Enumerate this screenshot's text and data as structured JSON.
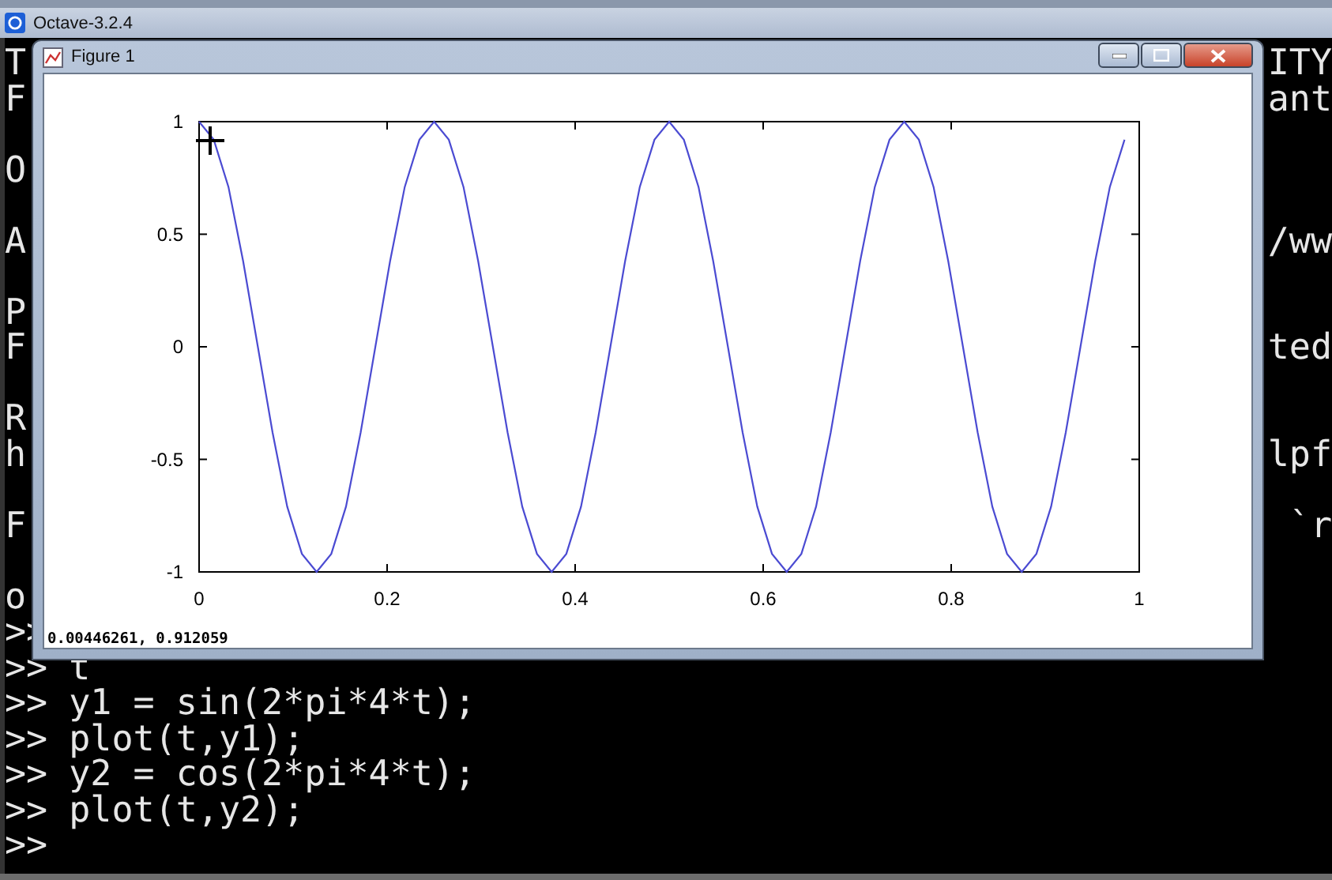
{
  "console": {
    "title": "Octave-3.2.4",
    "lines": [
      {
        "kind": "text",
        "left": "T",
        "right": "ITY"
      },
      {
        "kind": "text",
        "left": "F",
        "right": "ant"
      },
      {
        "kind": "blank"
      },
      {
        "kind": "text",
        "left": "O"
      },
      {
        "kind": "blank"
      },
      {
        "kind": "text",
        "left": "A",
        "right": "/ww"
      },
      {
        "kind": "blank"
      },
      {
        "kind": "text",
        "left": "P"
      },
      {
        "kind": "text",
        "left": "F",
        "right": "ted"
      },
      {
        "kind": "blank"
      },
      {
        "kind": "text",
        "left": "R"
      },
      {
        "kind": "text",
        "left": "h",
        "right": "lpf"
      },
      {
        "kind": "blank"
      },
      {
        "kind": "text",
        "left": "F",
        "right": "`r"
      },
      {
        "kind": "blank"
      },
      {
        "kind": "text",
        "left": "o"
      },
      {
        "kind": "text",
        "left": ">>"
      },
      {
        "kind": "text",
        "left": ">> t"
      },
      {
        "kind": "text",
        "left": ">> y1 = sin(2*pi*4*t);"
      },
      {
        "kind": "text",
        "left": ">> plot(t,y1);"
      },
      {
        "kind": "text",
        "left": ">> y2 = cos(2*pi*4*t);"
      },
      {
        "kind": "text",
        "left": ">> plot(t,y2);"
      },
      {
        "kind": "text",
        "left": ">>"
      }
    ]
  },
  "figure": {
    "title": "Figure 1",
    "status": "0.00446261, 0.912059",
    "chart_data": {
      "type": "line",
      "x": [
        0,
        0.015625,
        0.03125,
        0.046875,
        0.0625,
        0.078125,
        0.09375,
        0.109375,
        0.125,
        0.140625,
        0.15625,
        0.171875,
        0.1875,
        0.203125,
        0.21875,
        0.234375,
        0.25,
        0.265625,
        0.28125,
        0.296875,
        0.3125,
        0.328125,
        0.34375,
        0.359375,
        0.375,
        0.390625,
        0.40625,
        0.421875,
        0.4375,
        0.453125,
        0.46875,
        0.484375,
        0.5,
        0.515625,
        0.53125,
        0.546875,
        0.5625,
        0.578125,
        0.59375,
        0.609375,
        0.625,
        0.640625,
        0.65625,
        0.671875,
        0.6875,
        0.703125,
        0.71875,
        0.734375,
        0.75,
        0.765625,
        0.78125,
        0.796875,
        0.8125,
        0.828125,
        0.84375,
        0.859375,
        0.875,
        0.890625,
        0.90625,
        0.921875,
        0.9375,
        0.953125,
        0.96875,
        0.984375
      ],
      "series": [
        {
          "color": "#4b4bd2",
          "values": [
            1,
            0.92,
            0.71,
            0.38,
            0,
            -0.38,
            -0.71,
            -0.92,
            -1,
            -0.92,
            -0.71,
            -0.38,
            0,
            0.38,
            0.71,
            0.92,
            1,
            0.92,
            0.71,
            0.38,
            0,
            -0.38,
            -0.71,
            -0.92,
            -1,
            -0.92,
            -0.71,
            -0.38,
            0,
            0.38,
            0.71,
            0.92,
            1,
            0.92,
            0.71,
            0.38,
            0,
            -0.38,
            -0.71,
            -0.92,
            -1,
            -0.92,
            -0.71,
            -0.38,
            0,
            0.38,
            0.71,
            0.92,
            1,
            0.92,
            0.71,
            0.38,
            0,
            -0.38,
            -0.71,
            -0.92,
            -1,
            -0.92,
            -0.71,
            -0.38,
            0,
            0.38,
            0.71,
            0.92
          ]
        }
      ],
      "xlim": [
        0,
        1
      ],
      "ylim": [
        -1,
        1
      ],
      "xticks": [
        0,
        0.2,
        0.4,
        0.6,
        0.8,
        1
      ],
      "yticks": [
        -1,
        -0.5,
        0,
        0.5,
        1
      ]
    }
  }
}
